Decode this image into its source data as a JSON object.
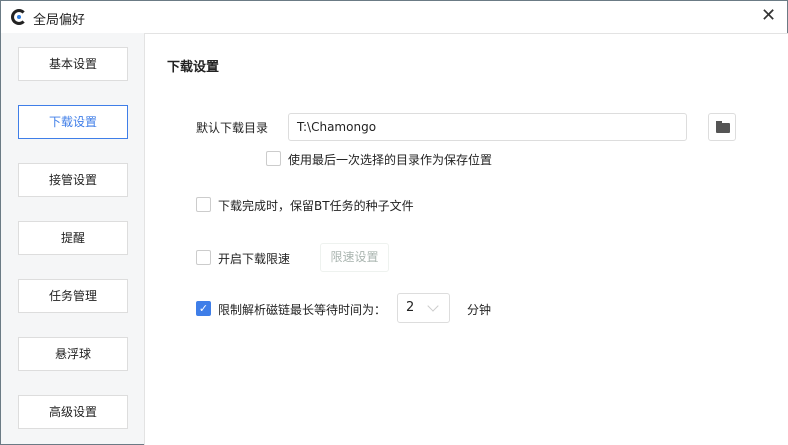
{
  "window": {
    "title": "全局偏好"
  },
  "sidebar": {
    "items": [
      {
        "label": "基本设置"
      },
      {
        "label": "下载设置"
      },
      {
        "label": "接管设置"
      },
      {
        "label": "提醒"
      },
      {
        "label": "任务管理"
      },
      {
        "label": "悬浮球"
      },
      {
        "label": "高级设置"
      }
    ],
    "active": "下载设置"
  },
  "main": {
    "heading": "下载设置",
    "dir_label": "默认下载目录",
    "dir_value": "T:\\Chamongo",
    "use_last_dir": {
      "label": "使用最后一次选择的目录作为保存位置",
      "checked": false
    },
    "keep_torrent": {
      "label": "下载完成时，保留BT任务的种子文件",
      "checked": false
    },
    "speed_limit": {
      "label": "开启下载限速",
      "checked": false,
      "button": "限速设置"
    },
    "magnet": {
      "label": "限制解析磁链最长等待时间为：",
      "checked": true,
      "value": "2",
      "unit": "分钟"
    }
  }
}
